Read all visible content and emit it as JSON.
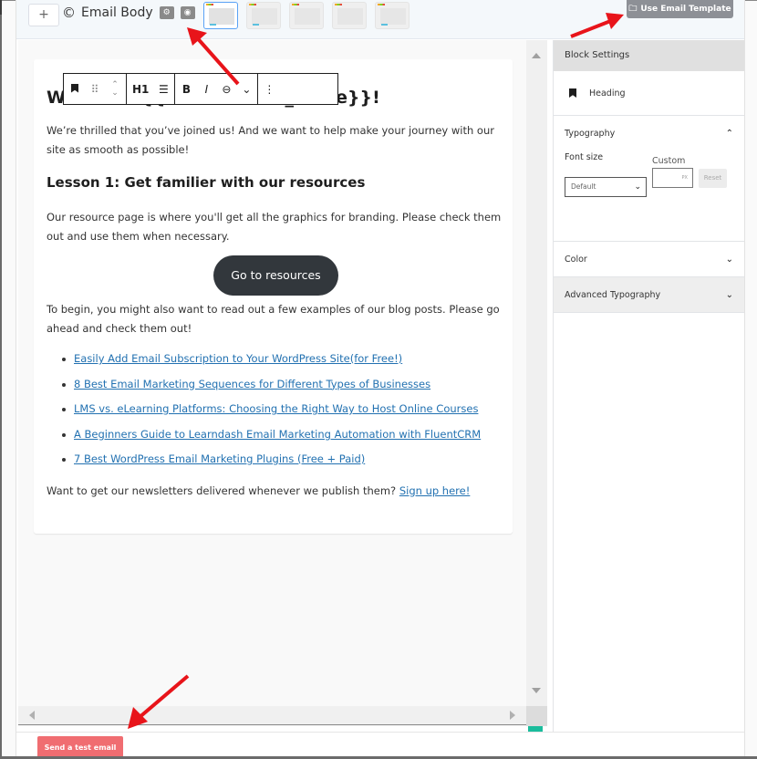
{
  "header": {
    "add_label": "+",
    "title": "Email Body",
    "title_icon": "©",
    "settings_icon": "gear-icon",
    "preview_icon": "eye-icon",
    "templates": [
      {
        "name": "simple",
        "active": true
      },
      {
        "name": "image-header",
        "active": false
      },
      {
        "name": "text-list",
        "active": false
      },
      {
        "name": "document",
        "active": false
      },
      {
        "name": "code-html",
        "active": false
      }
    ],
    "use_template_label": "Use Email Template"
  },
  "toolbar": {
    "block_icon": "bookmark-icon",
    "drag_icon": "drag-handle-icon",
    "move_icon": "move-up-down-icon",
    "heading_level": "H1",
    "align_icon": "align-left-icon",
    "bold": "B",
    "italic": "I",
    "link_icon": "link-icon",
    "more_format_icon": "chevron-down-icon",
    "options_icon": "more-vertical-icon"
  },
  "email": {
    "heading": "Welcome {{contact.first_name}}!",
    "intro": "We’re thrilled that you’ve joined us! And we want to help make your journey with our site as smooth as possible!",
    "lesson_heading": "Lesson 1: Get familier with our resources",
    "resources_text": "Our resource page is where you'll get all the graphics for branding. Please check them out and use them when necessary.",
    "cta_label": "Go to resources",
    "blog_intro": "To begin, you might also want to read out a few examples of our blog posts. Please go ahead and check them out!",
    "links": [
      "Easily Add Email Subscription to Your WordPress Site(for Free!)",
      "8 Best Email Marketing Sequences for Different Types of Businesses",
      "LMS vs. eLearning Platforms: Choosing the Right Way to Host Online Courses",
      "A Beginners Guide to Learndash Email Marketing Automation with FluentCRM",
      "7 Best WordPress Email Marketing Plugins (Free + Paid)"
    ],
    "signup_text": "Want to get our newsletters delivered whenever we publish them? ",
    "signup_link": "Sign up here!"
  },
  "sidebar": {
    "title": "Block Settings",
    "block_name": "Heading",
    "typography": {
      "label": "Typography",
      "font_size_label": "Font size",
      "font_size_value": "Default",
      "custom_label": "Custom",
      "custom_value": "",
      "custom_unit": "PX",
      "reset_label": "Reset"
    },
    "color_label": "Color",
    "advanced_typography_label": "Advanced Typography"
  },
  "footer": {
    "send_test_label": "Send a test email"
  },
  "colors": {
    "accent_blue": "#2271b1",
    "send_button": "#f06d71",
    "cta_button": "#32373c",
    "annotation_arrow": "#e8141a"
  }
}
